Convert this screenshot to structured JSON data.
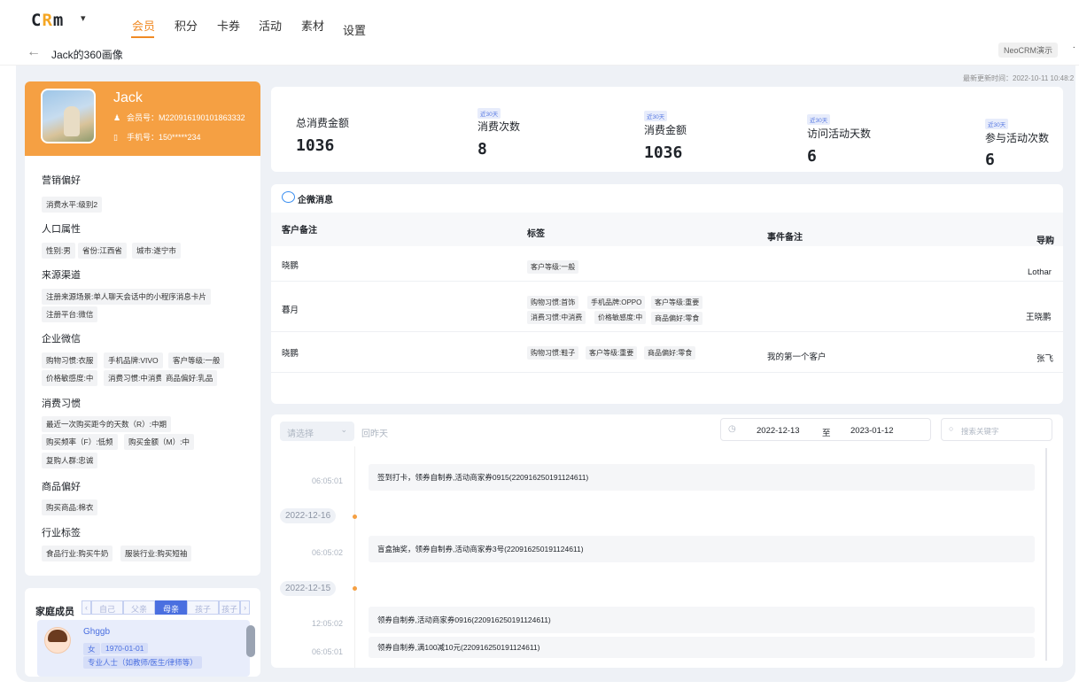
{
  "app": {
    "logo_c": "C",
    "logo_r": "R",
    "logo_m": "m",
    "logo_caret": "▾"
  },
  "nav": {
    "items": [
      "会员",
      "积分",
      "卡券",
      "活动",
      "素材",
      "设置"
    ],
    "active_index": 0
  },
  "subbar": {
    "back_icon": "arrow-left-icon",
    "title": "Jack的360画像",
    "tenant": "NeoCRM演示",
    "tenant_more": "·"
  },
  "update_time": "最新更新时间：2022-10-11 10:48:2",
  "profile": {
    "name": "Jack",
    "member_no": "会员号：M220916190101863332",
    "phone": "手机号：150*****234",
    "sections": [
      {
        "title": "营销偏好",
        "tags": [
          "消费水平:级别2"
        ]
      },
      {
        "title": "人口属性",
        "tags": [
          "性别:男",
          "省份:江西省",
          "城市:遂宁市"
        ]
      },
      {
        "title": "来源渠道",
        "tags": [
          "注册来源场景:单人聊天会话中的小程序消息卡片",
          "注册平台:微信"
        ]
      },
      {
        "title": "企业微信",
        "tags": [
          "购物习惯:衣服",
          "手机品牌:VIVO",
          "客户等级:一般",
          "价格敏感度:中",
          "消费习惯:中消费",
          "商品偏好:乳品"
        ]
      },
      {
        "title": "消费习惯",
        "tags": [
          "最近一次购买距今的天数（R）:中期",
          "购买频率（F）:低频",
          "购买金额（M）:中",
          "复购人群:忠诚"
        ]
      },
      {
        "title": "商品偏好",
        "tags": [
          "购买商品:棉衣"
        ]
      },
      {
        "title": "行业标签",
        "tags": [
          "食品行业:购买牛奶",
          "服装行业:购买短袖"
        ]
      }
    ]
  },
  "family": {
    "title": "家庭成员",
    "tabs": [
      "自己",
      "父亲",
      "母亲",
      "孩子",
      "孩子"
    ],
    "active_tab": 2,
    "prev": "‹",
    "next": "›",
    "member": {
      "name": "Ghggb",
      "gender": "女",
      "birthday": "1970-01-01",
      "occupation": "专业人士（如教师/医生/律师等）"
    }
  },
  "stats": [
    {
      "label": "总消费金额",
      "value": "1036",
      "badge": ""
    },
    {
      "label": "消费次数",
      "value": "8",
      "badge": "近30天"
    },
    {
      "label": "消费金额",
      "value": "1036",
      "badge": "近30天"
    },
    {
      "label": "访问活动天数",
      "value": "6",
      "badge": "近30天"
    },
    {
      "label": "参与活动次数",
      "value": "6",
      "badge": "近30天"
    }
  ],
  "wecom": {
    "title": "企微消息",
    "headers": [
      "客户备注",
      "标签",
      "事件备注",
      "导购"
    ],
    "rows": [
      {
        "note": "晓鹏",
        "tags": [
          "客户等级:一般"
        ],
        "event": "",
        "guide": "Lothar"
      },
      {
        "note": "暮月",
        "tags": [
          "购物习惯:首饰",
          "手机品牌:OPPO",
          "客户等级:重要",
          "消费习惯:中消费",
          "价格敏感度:中",
          "商品偏好:零食"
        ],
        "event": "",
        "guide": "王晓鹏"
      },
      {
        "note": "晓鹏",
        "tags": [
          "购物习惯:鞋子",
          "客户等级:重要",
          "商品偏好:零食"
        ],
        "event": "我的第一个客户",
        "guide": "张飞"
      }
    ]
  },
  "timeline": {
    "select_placeholder": "请选择",
    "yesterday": "回昨天",
    "date_from": "2022-12-13",
    "date_to_label": "至",
    "date_to": "2023-01-12",
    "search_placeholder": "搜索关键字",
    "entries": [
      {
        "type": "event",
        "time": "06:05:01",
        "text": "签到打卡，领券自制券,活动商家券0915(220916250191124611)"
      },
      {
        "type": "date",
        "text": "2022-12-16"
      },
      {
        "type": "event",
        "time": "06:05:02",
        "text": "盲盒抽奖，领券自制券,活动商家券3号(220916250191124611)"
      },
      {
        "type": "date",
        "text": "2022-12-15"
      },
      {
        "type": "event",
        "time": "12:05:02",
        "text": "领券自制券,活动商家券0916(220916250191124611)"
      },
      {
        "type": "event",
        "time": "06:05:01",
        "text": "领券自制券,满100减10元(220916250191124611)"
      }
    ]
  }
}
